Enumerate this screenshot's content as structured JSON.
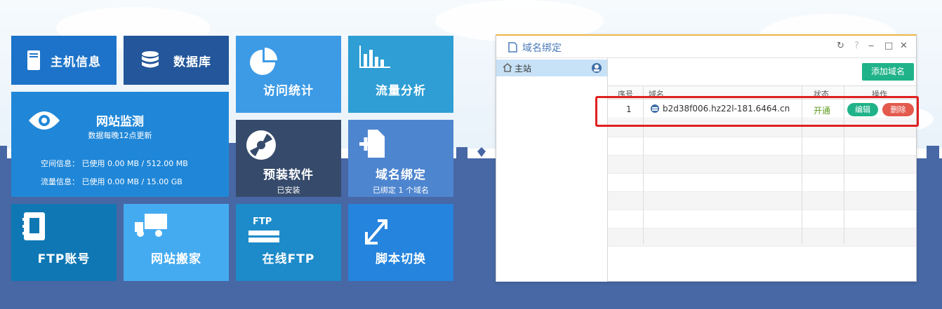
{
  "tiles": {
    "host_info": "主机信息",
    "database": "数据库",
    "visit_stats": "访问统计",
    "traffic": "流量分析",
    "monitor": {
      "title": "网站监测",
      "subtitle": "数据每晚12点更新",
      "space": "空间信息： 已使用 0.00 MB / 512.00 MB",
      "flow": "流量信息： 已使用 0.00 MB / 15.00 GB"
    },
    "preinstall": {
      "label": "预装软件",
      "sub": "已安装"
    },
    "domain": {
      "label": "域名绑定",
      "sub": "已绑定 1 个域名"
    },
    "ftp_account": "FTP账号",
    "site_move": "网站搬家",
    "online_ftp": "在线FTP",
    "ftp_icon_text": "FTP",
    "script_switch": "脚本切换"
  },
  "dialog": {
    "title": "域名绑定",
    "help": "?",
    "sidebar_item": "主站",
    "add_button": "添加域名",
    "columns": [
      "序号",
      "域名",
      "状态",
      "操作"
    ],
    "rows": [
      {
        "num": "1",
        "domain": "b2d38f006.hz22l-181.6464.cn",
        "status": "开通",
        "edit": "编辑",
        "delete": "删除"
      }
    ]
  },
  "colors": {
    "accent_green": "#20b38a",
    "delete_red": "#e35a4d",
    "highlight_red": "#e02020",
    "ground_blue": "#4767a5"
  }
}
